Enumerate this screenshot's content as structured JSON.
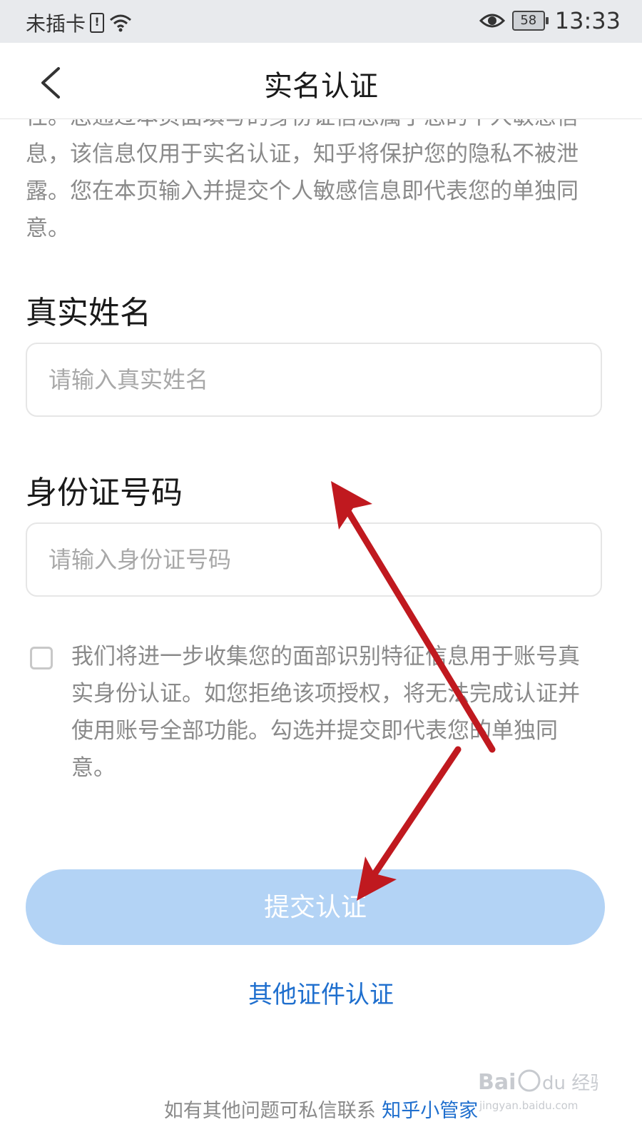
{
  "status_bar": {
    "carrier": "未插卡",
    "battery": "58",
    "time": "13:33"
  },
  "header": {
    "title": "实名认证"
  },
  "notice_text": "性。您通过本页面填写的身份证信息属于您的个人敏感信息，该信息仅用于实名认证，知乎将保护您的隐私不被泄露。您在本页输入并提交个人敏感信息即代表您的单独同意。",
  "form": {
    "name_label": "真实姓名",
    "name_placeholder": "请输入真实姓名",
    "id_label": "身份证号码",
    "id_placeholder": "请输入身份证号码"
  },
  "consent": {
    "text": "我们将进一步收集您的面部识别特征信息用于账号真实身份认证。如您拒绝该项授权，将无法完成认证并使用账号全部功能。勾选并提交即代表您的单独同意。",
    "checked": false
  },
  "actions": {
    "submit_label": "提交认证",
    "other_label": "其他证件认证"
  },
  "footer": {
    "text": "如有其他问题可私信联系",
    "link": "知乎小管家"
  },
  "watermark": {
    "brand": "Bai du 经验",
    "url": "jingyan.baidu.com"
  },
  "colors": {
    "accent": "#1f6fce",
    "button_disabled": "#b3d3f5",
    "annotation_arrow": "#c0191f"
  }
}
